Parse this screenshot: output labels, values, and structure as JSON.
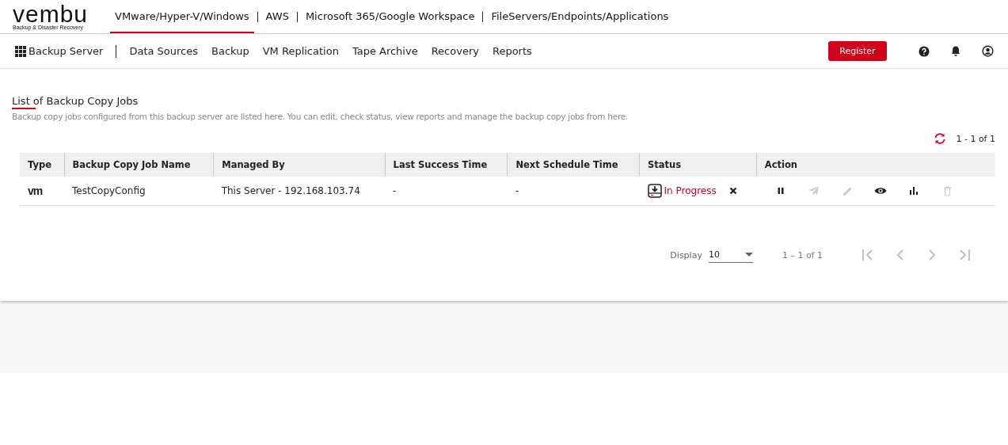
{
  "logo": {
    "name": "vembu",
    "tagline": "Backup & Disaster Recovery"
  },
  "product_tabs": [
    {
      "label": "VMware/Hyper-V/Windows",
      "selected": true
    },
    {
      "label": "AWS",
      "selected": false
    },
    {
      "label": "Microsoft 365/Google Workspace",
      "selected": false
    },
    {
      "label": "FileServers/Endpoints/Applications",
      "selected": false
    }
  ],
  "nav": {
    "home": "Backup Server",
    "items": [
      "Data Sources",
      "Backup",
      "VM Replication",
      "Tape Archive",
      "Recovery",
      "Reports"
    ],
    "register": "Register"
  },
  "page": {
    "title": "List of Backup Copy Jobs",
    "description": "Backup copy jobs configured from this backup server are listed here. You can edit, check status, view reports and manage the backup copy jobs from here.",
    "range": "1 - 1 of 1"
  },
  "table": {
    "columns": [
      "Type",
      "Backup Copy Job Name",
      "Managed By",
      "Last Success Time",
      "Next Schedule Time",
      "Status",
      "Action"
    ],
    "rows": [
      {
        "type": "vm",
        "name": "TestCopyConfig",
        "managed_by": "This Server - 192.168.103.74",
        "last_success": "-",
        "next_schedule": "-",
        "status": "In Progress",
        "actions": [
          {
            "kind": "pause",
            "disabled": false
          },
          {
            "kind": "send",
            "disabled": true
          },
          {
            "kind": "edit",
            "disabled": true
          },
          {
            "kind": "view",
            "disabled": false
          },
          {
            "kind": "report",
            "disabled": false
          },
          {
            "kind": "delete",
            "disabled": true
          }
        ]
      }
    ]
  },
  "pagination": {
    "label": "Display",
    "page_size": "10",
    "range": "1 – 1 of 1",
    "buttons": [
      {
        "kind": "first",
        "disabled": true
      },
      {
        "kind": "prev",
        "disabled": true
      },
      {
        "kind": "next",
        "disabled": true
      },
      {
        "kind": "last",
        "disabled": true
      }
    ]
  }
}
